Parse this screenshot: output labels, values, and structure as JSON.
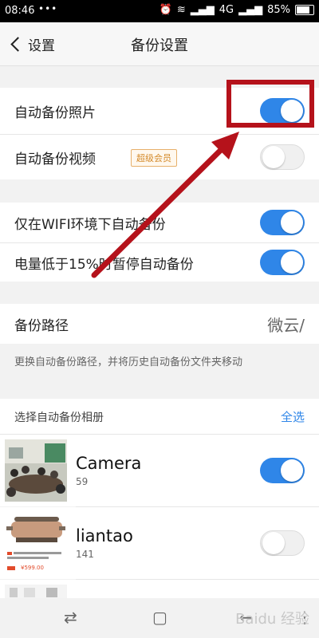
{
  "status": {
    "time": "08:46",
    "dots": "•••",
    "network": "4G",
    "battery": "85%"
  },
  "header": {
    "back_label": "设置",
    "title": "备份设置"
  },
  "settings": {
    "auto_photo": {
      "label": "自动备份照片",
      "enabled": true
    },
    "auto_video": {
      "label": "自动备份视频",
      "badge": "超级会员",
      "enabled": false
    },
    "wifi_only": {
      "label": "仅在WIFI环境下自动备份",
      "enabled": true
    },
    "low_battery": {
      "label": "电量低于15%时暂停自动备份",
      "enabled": true
    }
  },
  "path": {
    "label": "备份路径",
    "value": "微云/",
    "hint": "更换自动备份路径，并将历史自动备份文件夹移动"
  },
  "albums_section": {
    "title": "选择自动备份相册",
    "select_all": "全选"
  },
  "albums": [
    {
      "name": "Camera",
      "count": "59",
      "enabled": true
    },
    {
      "name": "liantao",
      "count": "141",
      "enabled": false
    }
  ],
  "thumb2": {
    "price": "¥599.00"
  },
  "watermark": "Baidu 经验",
  "colors": {
    "accent": "#2f86e8",
    "annotation": "#b5121b"
  }
}
